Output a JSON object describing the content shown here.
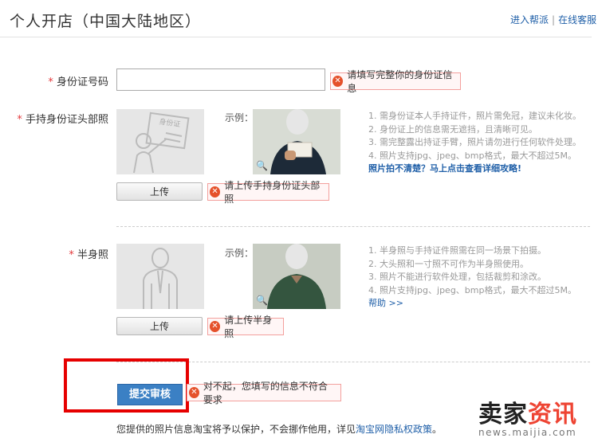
{
  "header": {
    "title": "个人开店（中国大陆地区）",
    "help_link": "进入帮派",
    "sep": "|",
    "service_link": "在线客服"
  },
  "id_field": {
    "required": "*",
    "label": "身份证号码",
    "value": "",
    "error": "请填写完整你的身份证信息"
  },
  "hand_photo": {
    "required": "*",
    "label": "手持身份证头部照",
    "example_label": "示例：",
    "upload_label": "上传",
    "error": "请上传手持身份证头部照",
    "tips": [
      "1. 需身份证本人手持证件，照片需免冠，建议未化妆。",
      "2. 身份证上的信息需无遮挡，且清晰可见。",
      "3. 需完整露出持证手臂，照片请勿进行任何软件处理。",
      "4. 照片支持jpg、jpeg、bmp格式，最大不超过5M。"
    ],
    "tips_link": "照片拍不清楚？马上点击查看详细攻略!"
  },
  "half_photo": {
    "required": "*",
    "label": "半身照",
    "example_label": "示例：",
    "upload_label": "上传",
    "error": "请上传半身照",
    "tips": [
      "1. 半身照与手持证件照需在同一场景下拍摄。",
      "2. 大头照和一寸照不可作为半身照使用。",
      "3. 照片不能进行软件处理，包括裁剪和涂改。",
      "4. 照片支持jpg、jpeg、bmp格式，最大不超过5M。"
    ],
    "tips_link": "帮助 >>"
  },
  "submit": {
    "label": "提交审核",
    "error": "对不起，您填写的信息不符合要求"
  },
  "footer": {
    "text": "您提供的照片信息淘宝将予以保护，不会挪作他用，详见",
    "link": "淘宝网隐私权政策",
    "end": "。"
  },
  "watermark": {
    "big_a": "卖家",
    "big_b": "资讯",
    "small": "news.maijia.com"
  },
  "colors": {
    "accent": "#3b80c4",
    "error_red": "#e5512b",
    "highlight_box": "#e60000",
    "link": "#1f5fa8"
  },
  "icons": {
    "error": "error-x-icon",
    "magnifier": "magnifier-icon",
    "id_placeholder": "id-card-person-icon",
    "body_placeholder": "person-silhouette-icon"
  }
}
